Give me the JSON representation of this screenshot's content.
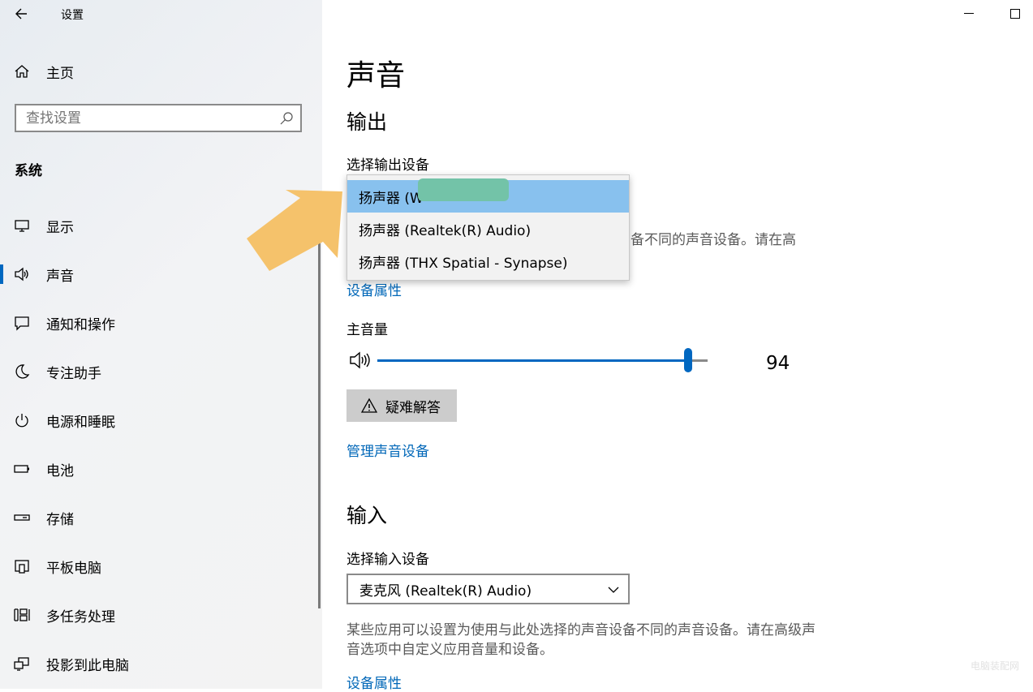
{
  "window": {
    "title": "设置",
    "back_icon": "back-arrow-icon"
  },
  "sidebar": {
    "home_label": "主页",
    "search_placeholder": "查找设置",
    "section_label": "系统",
    "items": [
      {
        "label": "显示",
        "icon": "display-icon"
      },
      {
        "label": "声音",
        "icon": "speaker-icon",
        "active": true
      },
      {
        "label": "通知和操作",
        "icon": "notification-icon"
      },
      {
        "label": "专注助手",
        "icon": "moon-icon"
      },
      {
        "label": "电源和睡眠",
        "icon": "power-icon"
      },
      {
        "label": "电池",
        "icon": "battery-icon"
      },
      {
        "label": "存储",
        "icon": "storage-icon"
      },
      {
        "label": "平板电脑",
        "icon": "tablet-icon"
      },
      {
        "label": "多任务处理",
        "icon": "multitask-icon"
      },
      {
        "label": "投影到此电脑",
        "icon": "project-icon"
      }
    ]
  },
  "main": {
    "title": "声音",
    "output": {
      "heading": "输出",
      "select_label": "选择输出设备",
      "dropdown_options": [
        "扬声器 (W",
        "扬声器 (Realtek(R) Audio)",
        "扬声器 (THX Spatial - Synapse)"
      ],
      "selected_index": 0,
      "desc_partial": "备不同的声音设备。请在高",
      "device_properties_link": "设备属性",
      "volume_label": "主音量",
      "volume_value": "94",
      "volume_level": 94,
      "troubleshoot_label": "疑难解答",
      "manage_link": "管理声音设备"
    },
    "input": {
      "heading": "输入",
      "select_label": "选择输入设备",
      "selected": "麦克风 (Realtek(R) Audio)",
      "desc": "某些应用可以设置为使用与此处选择的声音设备不同的声音设备。请在高级声音选项中自定义应用音量和设备。",
      "device_properties_link": "设备属性"
    }
  },
  "colors": {
    "accent": "#0067c0",
    "link": "#0067b8",
    "selected_option": "#88c1ee",
    "arrow": "#f5c26b"
  }
}
